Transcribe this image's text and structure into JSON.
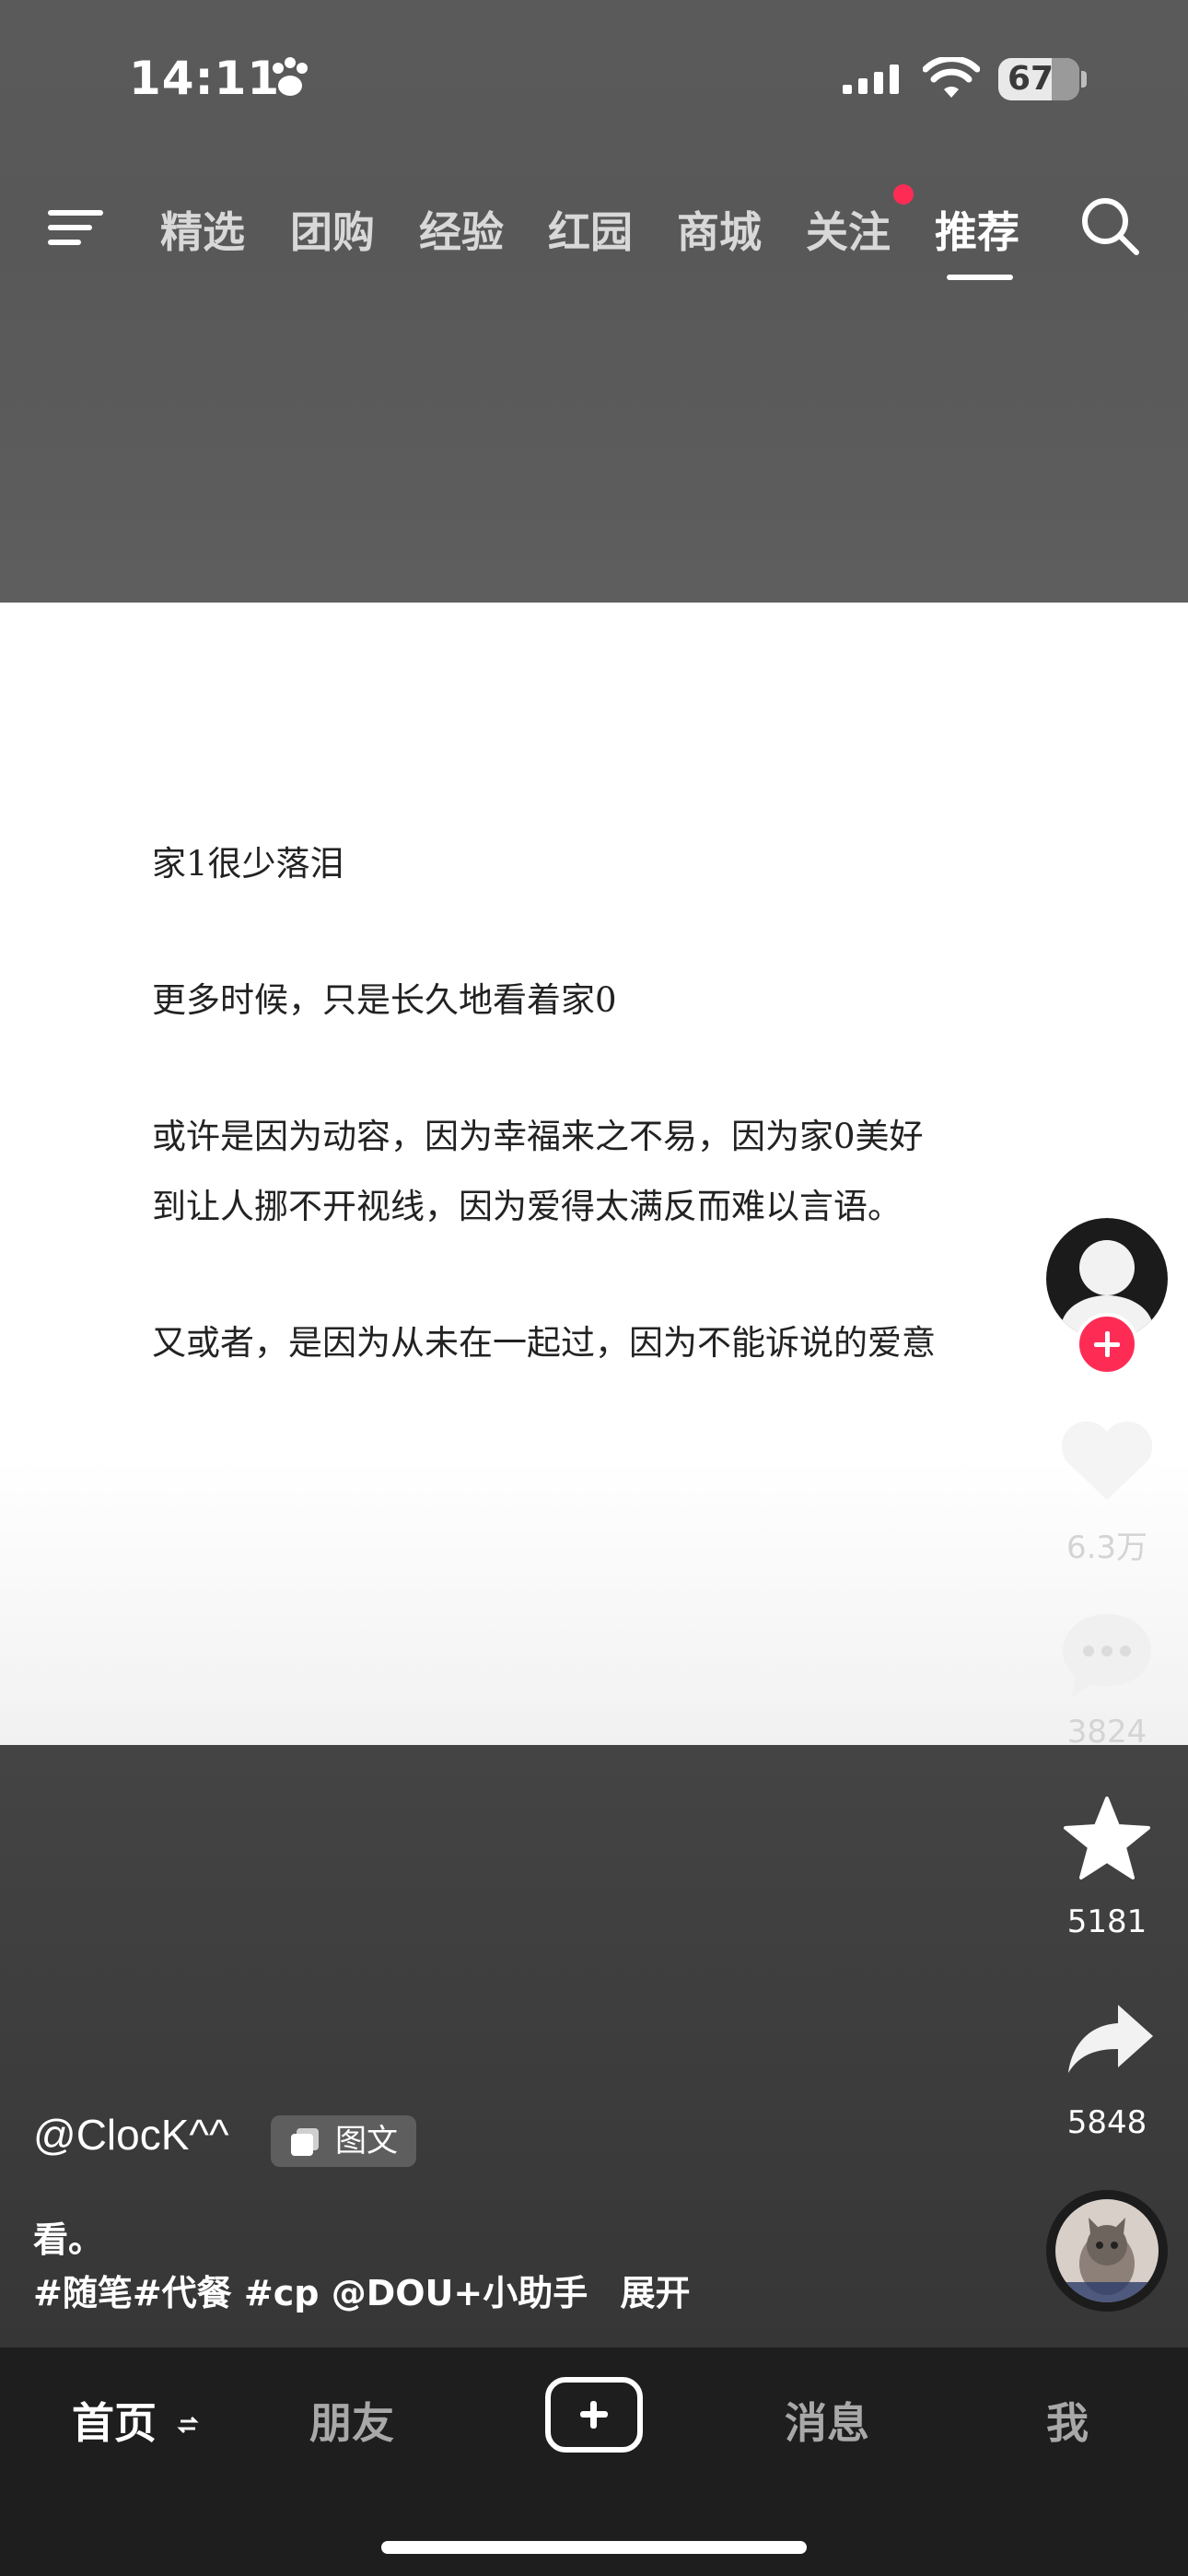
{
  "status": {
    "time": "14:11",
    "battery": "67"
  },
  "nav": {
    "tabs": [
      {
        "label": "精选"
      },
      {
        "label": "团购"
      },
      {
        "label": "经验"
      },
      {
        "label": "红园"
      },
      {
        "label": "商城"
      },
      {
        "label": "关注"
      },
      {
        "label": "推荐"
      }
    ],
    "active_tab": "推荐"
  },
  "post": {
    "paragraphs": [
      "家1很少落泪",
      "更多时候，只是长久地看着家0",
      "或许是因为动容，因为幸福来之不易，因为家0美好",
      "到让人挪不开视线，因为爱得太满反而难以言语。",
      "又或者，是因为从未在一起过，因为不能诉说的爱意"
    ]
  },
  "actions": {
    "likes": "6.3万",
    "comments": "3824",
    "favorites": "5181",
    "shares": "5848"
  },
  "video_info": {
    "author": "@ClocK^^",
    "type_tag": "图文",
    "desc_line1": "看。",
    "desc_line2": "#随笔#代餐 #cp @DOU+小助手",
    "expand": "展开"
  },
  "tabbar": {
    "home": "首页",
    "friends": "朋友",
    "messages": "消息",
    "me": "我"
  },
  "colors": {
    "accent": "#fe2c55"
  }
}
